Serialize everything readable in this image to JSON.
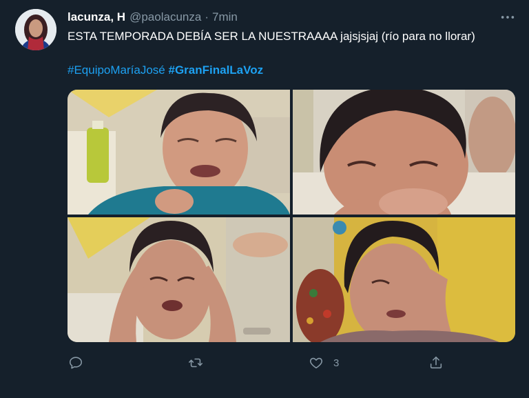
{
  "tweet": {
    "display_name": "lacunza, H",
    "handle": "@paolacunza",
    "separator": "·",
    "time": "7min",
    "text": "ESTA TEMPORADA DEBÍA SER LA NUESTRAAAA jajsjsjaj (río para no llorar)",
    "hashtags": [
      "#EquipoMaríaJosé",
      "#GranFinalLaVoz"
    ],
    "like_count": "3"
  },
  "icons": {
    "more": "more-dots-icon",
    "reply": "reply-icon",
    "retweet": "retweet-icon",
    "like": "heart-icon",
    "share": "share-icon"
  },
  "colors": {
    "background": "#15202b",
    "muted": "#8899a6",
    "accent": "#1da1f2"
  }
}
